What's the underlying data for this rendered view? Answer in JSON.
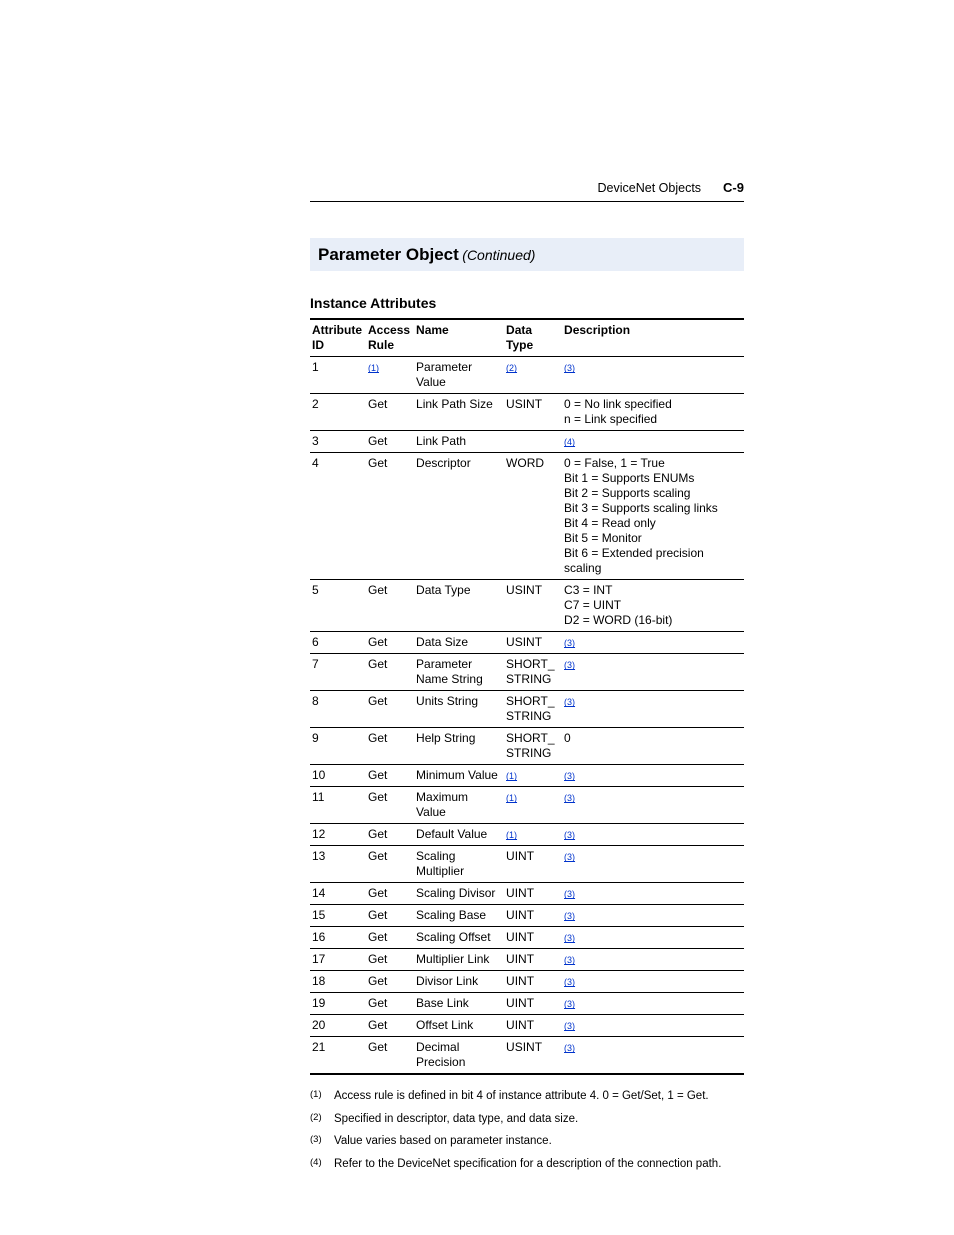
{
  "header": {
    "section": "DeviceNet Objects",
    "page": "C-9"
  },
  "section": {
    "title": "Parameter Object",
    "continued": "(Continued)"
  },
  "subheading": "Instance Attributes",
  "columns": {
    "attr_id": "Attribute ID",
    "access": "Access Rule",
    "name": "Name",
    "dtype": "Data Type",
    "desc": "Description"
  },
  "rows": [
    {
      "id": "1",
      "access_ref": "(1)",
      "name": "Parameter Value",
      "dtype_ref": "(2)",
      "desc_ref": "(3)"
    },
    {
      "id": "2",
      "access": "Get",
      "name": "Link Path Size",
      "dtype": "USINT",
      "desc": "0 = No link specified\nn = Link specified"
    },
    {
      "id": "3",
      "access": "Get",
      "name": "Link Path",
      "dtype": "",
      "desc_ref": "(4)"
    },
    {
      "id": "4",
      "access": "Get",
      "name": "Descriptor",
      "dtype": "WORD",
      "desc": "0 = False, 1 = True\nBit 1 = Supports ENUMs\nBit 2 = Supports scaling\nBit 3 = Supports scaling links\nBit 4 = Read only\nBit 5 = Monitor\nBit 6 = Extended precision scaling"
    },
    {
      "id": "5",
      "access": "Get",
      "name": "Data Type",
      "dtype": "USINT",
      "desc": "C3 = INT\nC7 = UINT\nD2 = WORD (16-bit)"
    },
    {
      "id": "6",
      "access": "Get",
      "name": "Data Size",
      "dtype": "USINT",
      "desc_ref": "(3)"
    },
    {
      "id": "7",
      "access": "Get",
      "name": "Parameter Name String",
      "dtype": "SHORT_\nSTRING",
      "desc_ref": "(3)"
    },
    {
      "id": "8",
      "access": "Get",
      "name": "Units String",
      "dtype": "SHORT_\nSTRING",
      "desc_ref": "(3)"
    },
    {
      "id": "9",
      "access": "Get",
      "name": "Help String",
      "dtype": "SHORT_\nSTRING",
      "desc": "0"
    },
    {
      "id": "10",
      "access": "Get",
      "name": "Minimum Value",
      "dtype_ref": "(1)",
      "desc_ref": "(3)"
    },
    {
      "id": "11",
      "access": "Get",
      "name": "Maximum Value",
      "dtype_ref": "(1)",
      "desc_ref": "(3)"
    },
    {
      "id": "12",
      "access": "Get",
      "name": "Default Value",
      "dtype_ref": "(1)",
      "desc_ref": "(3)"
    },
    {
      "id": "13",
      "access": "Get",
      "name": "Scaling Multiplier",
      "dtype": "UINT",
      "desc_ref": "(3)"
    },
    {
      "id": "14",
      "access": "Get",
      "name": "Scaling Divisor",
      "dtype": "UINT",
      "desc_ref": "(3)"
    },
    {
      "id": "15",
      "access": "Get",
      "name": "Scaling Base",
      "dtype": "UINT",
      "desc_ref": "(3)"
    },
    {
      "id": "16",
      "access": "Get",
      "name": "Scaling Offset",
      "dtype": "UINT",
      "desc_ref": "(3)"
    },
    {
      "id": "17",
      "access": "Get",
      "name": "Multiplier Link",
      "dtype": "UINT",
      "desc_ref": "(3)"
    },
    {
      "id": "18",
      "access": "Get",
      "name": "Divisor Link",
      "dtype": "UINT",
      "desc_ref": "(3)"
    },
    {
      "id": "19",
      "access": "Get",
      "name": "Base Link",
      "dtype": "UINT",
      "desc_ref": "(3)"
    },
    {
      "id": "20",
      "access": "Get",
      "name": "Offset Link",
      "dtype": "UINT",
      "desc_ref": "(3)"
    },
    {
      "id": "21",
      "access": "Get",
      "name": "Decimal Precision",
      "dtype": "USINT",
      "desc_ref": "(3)"
    }
  ],
  "footnotes": [
    {
      "num": "(1)",
      "text": "Access rule is defined in bit 4 of instance attribute 4. 0 = Get/Set, 1 = Get."
    },
    {
      "num": "(2)",
      "text": "Specified in descriptor, data type, and data size."
    },
    {
      "num": "(3)",
      "text": "Value varies based on parameter instance."
    },
    {
      "num": "(4)",
      "text": "Refer to the DeviceNet specification for a description of the connection path."
    }
  ]
}
